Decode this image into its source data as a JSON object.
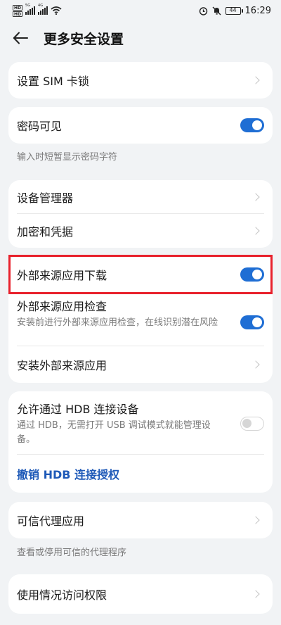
{
  "status_bar": {
    "time": "16:29",
    "battery": "44",
    "hd1": "HD",
    "hd2": "HD",
    "sig1_label": "5G",
    "sig2_label": "4G",
    "icons": [
      "signal-icon",
      "wifi-icon",
      "alarm-icon",
      "mute-icon",
      "battery-icon"
    ]
  },
  "header": {
    "title": "更多安全设置"
  },
  "items": {
    "sim_lock": "设置 SIM 卡锁",
    "password_visible": "密码可见",
    "password_visible_note": "输入时短暂显示密码字符",
    "device_admin": "设备管理器",
    "encryption": "加密和凭据",
    "external_download": "外部来源应用下载",
    "external_check": "外部来源应用检查",
    "external_check_desc": "安装前进行外部来源应用检查，在线识别潜在风险",
    "install_external": "安装外部来源应用",
    "hdb_allow": "允许通过 HDB 连接设备",
    "hdb_desc": "通过 HDB，无需打开 USB 调试模式就能管理设备。",
    "hdb_revoke": "撤销 HDB 连接授权",
    "trust_agents": "可信代理应用",
    "trust_agents_note": "查看或停用可信的代理程序",
    "usage_access": "使用情况访问权限"
  },
  "toggles": {
    "password_visible": true,
    "external_download": true,
    "external_check": true,
    "hdb_allow": false
  },
  "colors": {
    "accent": "#1f6ed4",
    "highlight": "#e8212c",
    "link": "#1f5ab8"
  }
}
